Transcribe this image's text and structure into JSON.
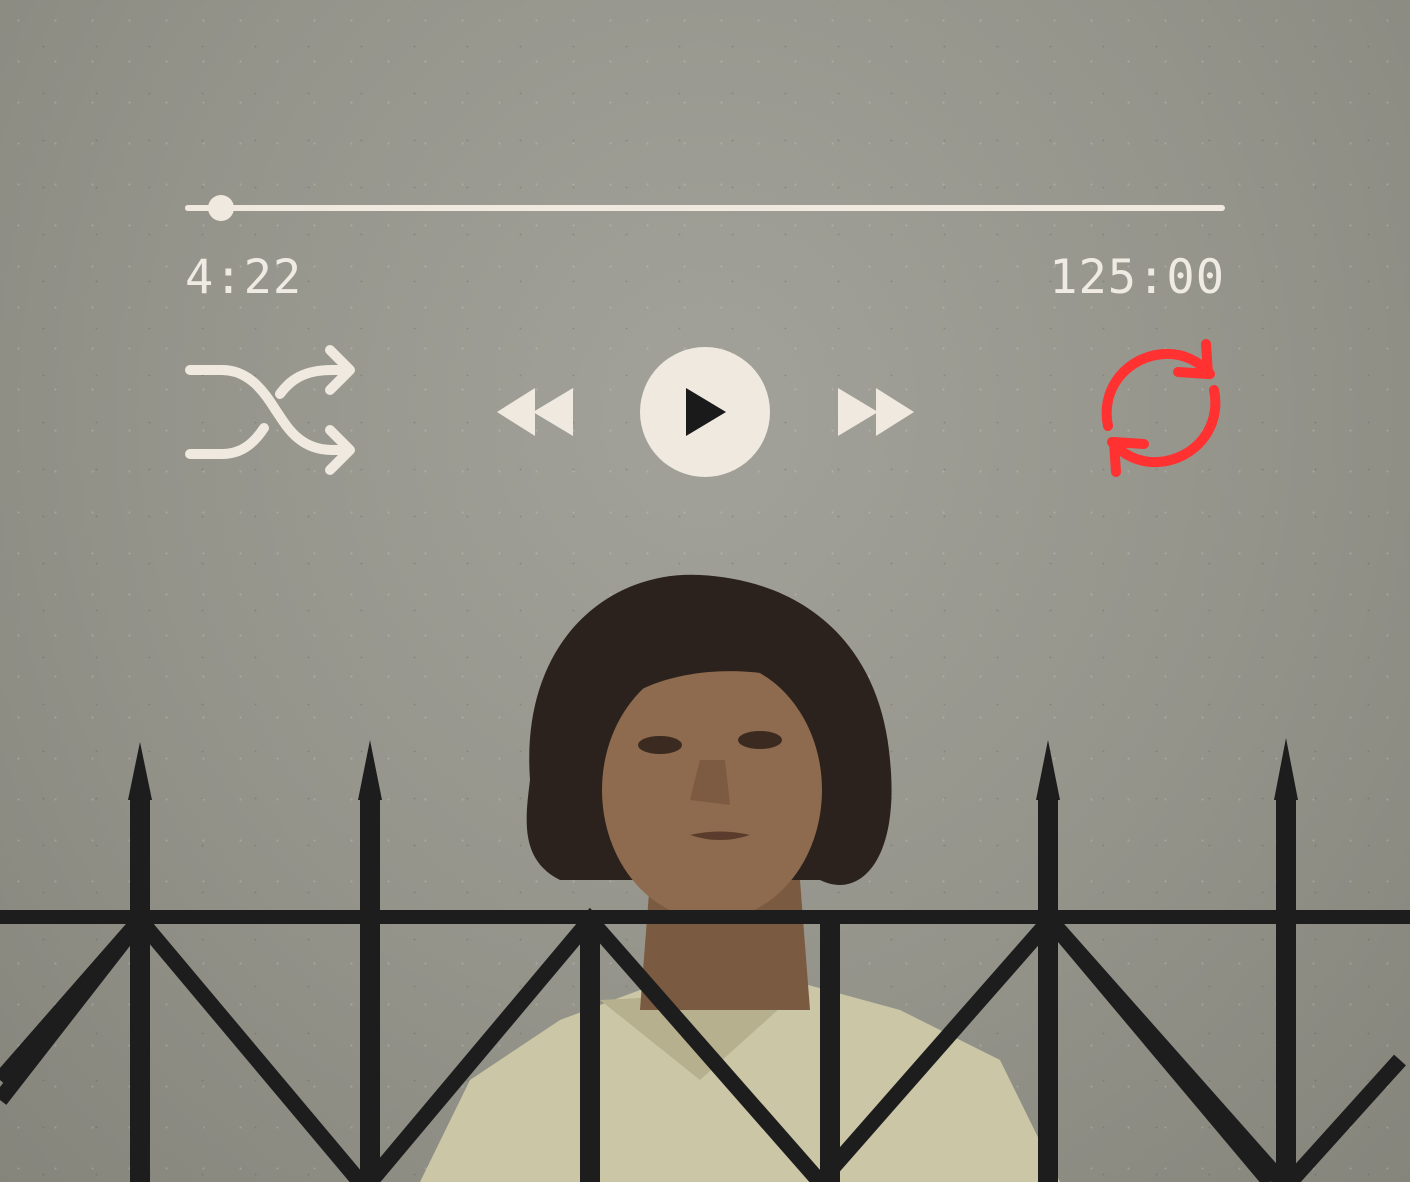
{
  "player": {
    "progress": 0.035,
    "elapsed": "4:22",
    "total": "125:00",
    "controls": {
      "shuffle_icon": "shuffle-icon",
      "rewind_icon": "rewind-icon",
      "play_icon": "play-icon",
      "forward_icon": "fast-forward-icon",
      "repeat_icon": "repeat-icon",
      "repeat_active": true
    }
  },
  "colors": {
    "control": "#efe9df",
    "active": "#ff3131",
    "background": "#98988f",
    "play_glyph": "#1a1a1a"
  }
}
